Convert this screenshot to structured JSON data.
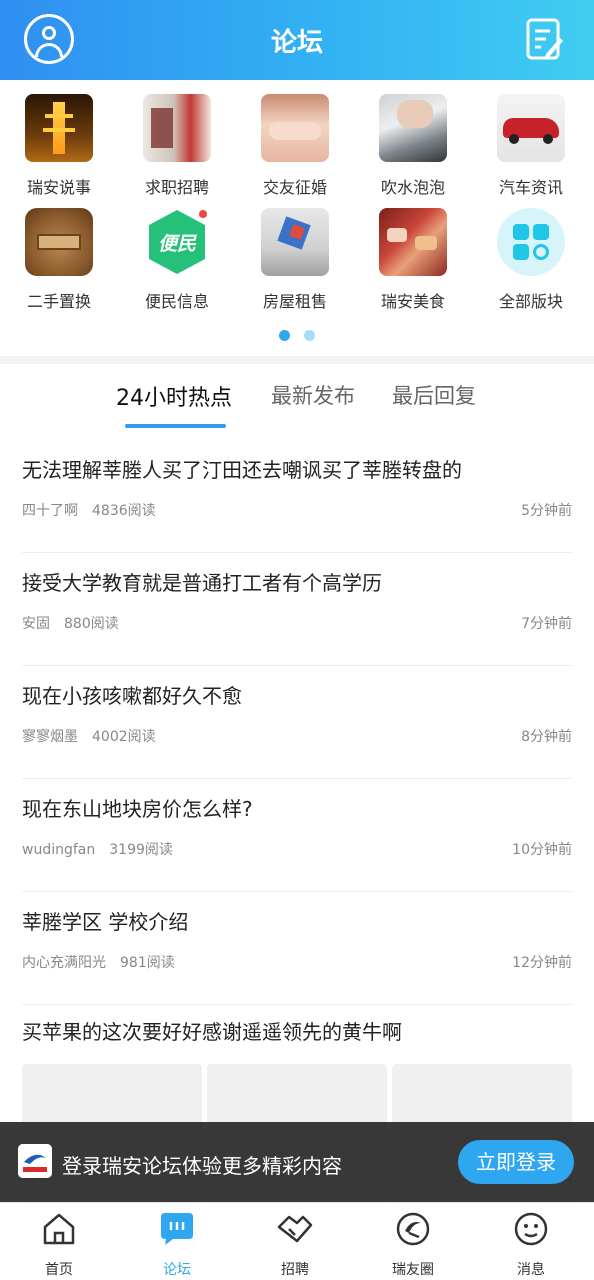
{
  "header": {
    "title": "论坛"
  },
  "categories": [
    {
      "label": "瑞安说事"
    },
    {
      "label": "求职招聘"
    },
    {
      "label": "交友征婚"
    },
    {
      "label": "吹水泡泡"
    },
    {
      "label": "汽车资讯"
    },
    {
      "label": "二手置换"
    },
    {
      "label": "便民信息",
      "icon_text": "便民"
    },
    {
      "label": "房屋租售"
    },
    {
      "label": "瑞安美食"
    },
    {
      "label": "全部版块"
    }
  ],
  "pager": {
    "active_index": 0,
    "count": 2
  },
  "tabs": [
    {
      "label": "24小时热点",
      "active": true
    },
    {
      "label": "最新发布"
    },
    {
      "label": "最后回复"
    }
  ],
  "posts": [
    {
      "title": "无法理解莘塍人买了汀田还去嘲讽买了莘塍转盘的",
      "author": "四十了啊",
      "reads": "4836阅读",
      "time": "5分钟前"
    },
    {
      "title": "接受大学教育就是普通打工者有个高学历",
      "author": "安固",
      "reads": "880阅读",
      "time": "7分钟前"
    },
    {
      "title": "现在小孩咳嗽都好久不愈",
      "author": "寥寥烟墨",
      "reads": "4002阅读",
      "time": "8分钟前"
    },
    {
      "title": "现在东山地块房价怎么样?",
      "author": "wudingfan",
      "reads": "3199阅读",
      "time": "10分钟前"
    },
    {
      "title": "莘塍学区 学校介绍",
      "author": "内心充满阳光",
      "reads": "981阅读",
      "time": "12分钟前"
    }
  ],
  "last_post": {
    "title": "买苹果的这次要好好感谢遥遥领先的黄牛啊"
  },
  "login_banner": {
    "text": "登录瑞安论坛体验更多精彩内容",
    "button": "立即登录"
  },
  "bottom_nav": [
    {
      "label": "首页"
    },
    {
      "label": "论坛",
      "active": true
    },
    {
      "label": "招聘"
    },
    {
      "label": "瑞友圈"
    },
    {
      "label": "消息"
    }
  ],
  "colors": {
    "accent": "#2fa6f0",
    "header_start": "#2f8ff1",
    "header_end": "#40cdf1"
  }
}
